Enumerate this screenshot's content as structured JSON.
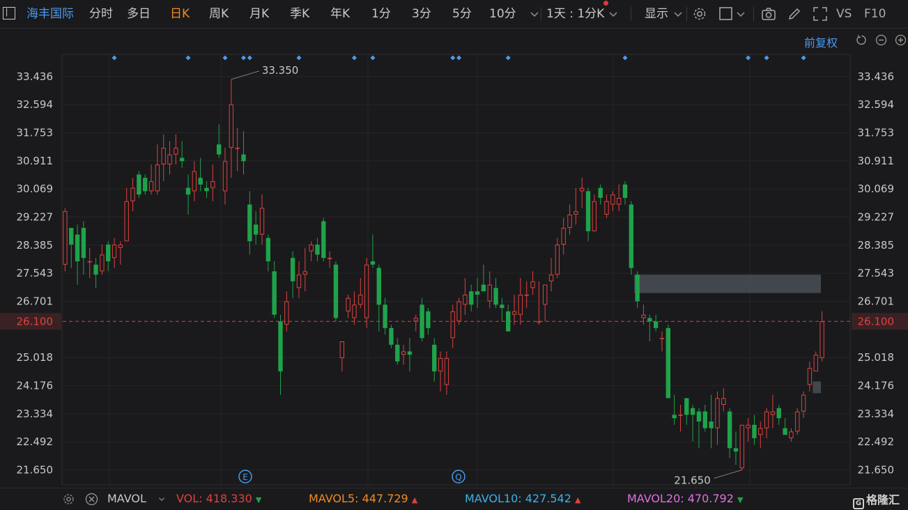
{
  "toolbar": {
    "stock_name": "海丰国际",
    "periods": [
      "分时",
      "多日",
      "日K",
      "周K",
      "月K",
      "季K",
      "年K",
      "1分",
      "3分",
      "5分",
      "10分"
    ],
    "active_period": "日K",
    "interval": "1天 : 1分K",
    "display": "显示",
    "vs": "VS",
    "f10": "F10"
  },
  "adjust": "前复权",
  "price_axis": {
    "ticks": [
      "33.436",
      "32.594",
      "31.753",
      "30.911",
      "30.069",
      "29.227",
      "28.385",
      "27.543",
      "26.701",
      "25.018",
      "24.176",
      "23.334",
      "22.492",
      "21.650"
    ],
    "current_price": "26.100",
    "high_label": "33.350",
    "low_label": "21.650"
  },
  "event_markers": [
    "E",
    "Q"
  ],
  "volume_bar": {
    "indicator": "MAVOL",
    "vol_label": "VOL:",
    "vol": "418.330",
    "mavol5_label": "MAVOL5:",
    "mavol5": "447.729",
    "mavol10_label": "MAVOL10:",
    "mavol10": "427.542",
    "mavol20_label": "MAVOL20:",
    "mavol20": "470.792"
  },
  "brand": "格隆汇",
  "colors": {
    "up": "#e0413f",
    "down": "#1fa34a",
    "accent_blue": "#4a9af0",
    "active_orange": "#f08a24",
    "mavol5": "#f08a24",
    "mavol10": "#3fb0e8",
    "mavol20": "#e070e0"
  },
  "chart_data": {
    "type": "candlestick",
    "ylim": [
      21.2,
      34.1
    ],
    "candles": [
      {
        "o": 27.8,
        "h": 29.5,
        "l": 27.6,
        "c": 29.4
      },
      {
        "o": 28.9,
        "h": 28.9,
        "l": 27.7,
        "c": 28.4
      },
      {
        "o": 28.7,
        "h": 29.0,
        "l": 27.2,
        "c": 27.9
      },
      {
        "o": 28.9,
        "h": 29.1,
        "l": 27.5,
        "c": 28.0
      },
      {
        "o": 27.9,
        "h": 28.3,
        "l": 27.4,
        "c": 27.9
      },
      {
        "o": 27.8,
        "h": 28.0,
        "l": 27.1,
        "c": 27.5
      },
      {
        "o": 27.6,
        "h": 28.4,
        "l": 27.5,
        "c": 28.1
      },
      {
        "o": 28.4,
        "h": 28.5,
        "l": 27.6,
        "c": 27.9
      },
      {
        "o": 28.0,
        "h": 28.6,
        "l": 27.7,
        "c": 28.4
      },
      {
        "o": 28.3,
        "h": 28.5,
        "l": 27.8,
        "c": 28.4
      },
      {
        "o": 28.5,
        "h": 30.1,
        "l": 28.5,
        "c": 29.7
      },
      {
        "o": 29.7,
        "h": 30.4,
        "l": 29.4,
        "c": 30.1
      },
      {
        "o": 30.5,
        "h": 30.6,
        "l": 29.8,
        "c": 29.9
      },
      {
        "o": 30.4,
        "h": 30.5,
        "l": 29.9,
        "c": 30.0
      },
      {
        "o": 30.0,
        "h": 30.8,
        "l": 29.9,
        "c": 30.3
      },
      {
        "o": 30.0,
        "h": 31.4,
        "l": 29.9,
        "c": 30.8
      },
      {
        "o": 30.8,
        "h": 31.7,
        "l": 30.3,
        "c": 31.3
      },
      {
        "o": 30.8,
        "h": 31.5,
        "l": 30.5,
        "c": 31.1
      },
      {
        "o": 31.1,
        "h": 31.7,
        "l": 30.8,
        "c": 31.3
      },
      {
        "o": 31.0,
        "h": 31.5,
        "l": 30.7,
        "c": 30.9
      },
      {
        "o": 30.1,
        "h": 30.5,
        "l": 29.3,
        "c": 29.9
      },
      {
        "o": 30.0,
        "h": 30.9,
        "l": 29.7,
        "c": 30.6
      },
      {
        "o": 30.4,
        "h": 31.0,
        "l": 30.0,
        "c": 30.2
      },
      {
        "o": 30.1,
        "h": 30.3,
        "l": 29.8,
        "c": 30.0
      },
      {
        "o": 30.1,
        "h": 30.8,
        "l": 29.7,
        "c": 30.3
      },
      {
        "o": 31.4,
        "h": 32.0,
        "l": 31.0,
        "c": 31.1
      },
      {
        "o": 30.0,
        "h": 31.3,
        "l": 29.6,
        "c": 30.9
      },
      {
        "o": 31.3,
        "h": 33.35,
        "l": 30.4,
        "c": 32.6
      },
      {
        "o": 31.3,
        "h": 31.9,
        "l": 30.6,
        "c": 31.3
      },
      {
        "o": 31.1,
        "h": 31.8,
        "l": 30.5,
        "c": 30.9
      },
      {
        "o": 29.6,
        "h": 30.0,
        "l": 28.1,
        "c": 28.5
      },
      {
        "o": 29.0,
        "h": 29.4,
        "l": 28.4,
        "c": 28.7
      },
      {
        "o": 28.7,
        "h": 29.9,
        "l": 28.4,
        "c": 29.5
      },
      {
        "o": 28.6,
        "h": 28.7,
        "l": 27.6,
        "c": 27.9
      },
      {
        "o": 27.6,
        "h": 27.9,
        "l": 26.2,
        "c": 26.3
      },
      {
        "o": 26.1,
        "h": 26.3,
        "l": 23.9,
        "c": 24.6
      },
      {
        "o": 26.0,
        "h": 27.0,
        "l": 25.8,
        "c": 26.7
      },
      {
        "o": 28.0,
        "h": 28.2,
        "l": 26.8,
        "c": 27.3
      },
      {
        "o": 27.1,
        "h": 27.9,
        "l": 26.8,
        "c": 27.5
      },
      {
        "o": 27.5,
        "h": 28.3,
        "l": 27.0,
        "c": 27.6
      },
      {
        "o": 28.2,
        "h": 28.5,
        "l": 27.9,
        "c": 28.4
      },
      {
        "o": 28.4,
        "h": 28.6,
        "l": 27.9,
        "c": 28.1
      },
      {
        "o": 29.1,
        "h": 29.2,
        "l": 27.9,
        "c": 28.0
      },
      {
        "o": 28.0,
        "h": 28.2,
        "l": 27.7,
        "c": 28.0
      },
      {
        "o": 27.8,
        "h": 27.9,
        "l": 26.1,
        "c": 26.2
      },
      {
        "o": 25.0,
        "h": 25.5,
        "l": 24.6,
        "c": 25.5
      },
      {
        "o": 26.4,
        "h": 26.9,
        "l": 26.2,
        "c": 26.8
      },
      {
        "o": 26.2,
        "h": 27.0,
        "l": 26.0,
        "c": 26.6
      },
      {
        "o": 26.6,
        "h": 27.4,
        "l": 26.5,
        "c": 26.9
      },
      {
        "o": 26.2,
        "h": 28.0,
        "l": 25.9,
        "c": 27.8
      },
      {
        "o": 27.9,
        "h": 28.7,
        "l": 27.7,
        "c": 27.8
      },
      {
        "o": 27.7,
        "h": 27.8,
        "l": 25.8,
        "c": 26.6
      },
      {
        "o": 26.6,
        "h": 26.8,
        "l": 25.7,
        "c": 25.9
      },
      {
        "o": 25.9,
        "h": 26.0,
        "l": 25.3,
        "c": 25.4
      },
      {
        "o": 25.4,
        "h": 25.6,
        "l": 24.8,
        "c": 24.9
      },
      {
        "o": 25.1,
        "h": 25.4,
        "l": 24.8,
        "c": 25.2
      },
      {
        "o": 25.2,
        "h": 25.6,
        "l": 24.6,
        "c": 25.1
      },
      {
        "o": 26.1,
        "h": 26.3,
        "l": 25.8,
        "c": 26.2
      },
      {
        "o": 26.6,
        "h": 26.8,
        "l": 25.5,
        "c": 25.6
      },
      {
        "o": 26.4,
        "h": 26.5,
        "l": 25.7,
        "c": 25.9
      },
      {
        "o": 25.4,
        "h": 25.6,
        "l": 24.3,
        "c": 24.6
      },
      {
        "o": 24.6,
        "h": 25.2,
        "l": 24.0,
        "c": 25.0
      },
      {
        "o": 24.2,
        "h": 25.2,
        "l": 23.9,
        "c": 25.0
      },
      {
        "o": 25.6,
        "h": 26.6,
        "l": 25.3,
        "c": 26.4
      },
      {
        "o": 26.1,
        "h": 26.8,
        "l": 26.0,
        "c": 26.7
      },
      {
        "o": 26.6,
        "h": 27.4,
        "l": 26.3,
        "c": 26.9
      },
      {
        "o": 27.0,
        "h": 27.2,
        "l": 26.4,
        "c": 26.6
      },
      {
        "o": 27.0,
        "h": 27.4,
        "l": 26.5,
        "c": 26.9
      },
      {
        "o": 27.2,
        "h": 27.8,
        "l": 27.0,
        "c": 27.0
      },
      {
        "o": 26.7,
        "h": 27.6,
        "l": 26.5,
        "c": 27.2
      },
      {
        "o": 27.1,
        "h": 27.4,
        "l": 26.5,
        "c": 26.6
      },
      {
        "o": 26.6,
        "h": 26.8,
        "l": 26.1,
        "c": 26.5
      },
      {
        "o": 26.4,
        "h": 26.6,
        "l": 25.8,
        "c": 25.8
      },
      {
        "o": 26.3,
        "h": 26.9,
        "l": 26.0,
        "c": 26.4
      },
      {
        "o": 26.3,
        "h": 27.4,
        "l": 26.0,
        "c": 26.9
      },
      {
        "o": 26.9,
        "h": 27.3,
        "l": 26.5,
        "c": 26.9
      },
      {
        "o": 27.1,
        "h": 27.6,
        "l": 26.9,
        "c": 27.3
      },
      {
        "o": 26.1,
        "h": 27.3,
        "l": 26.0,
        "c": 26.1
      },
      {
        "o": 26.6,
        "h": 27.2,
        "l": 26.1,
        "c": 27.2
      },
      {
        "o": 27.3,
        "h": 28.0,
        "l": 27.0,
        "c": 27.5
      },
      {
        "o": 27.5,
        "h": 28.6,
        "l": 27.4,
        "c": 28.4
      },
      {
        "o": 28.4,
        "h": 29.2,
        "l": 28.1,
        "c": 28.9
      },
      {
        "o": 28.9,
        "h": 29.6,
        "l": 28.7,
        "c": 29.3
      },
      {
        "o": 29.3,
        "h": 30.1,
        "l": 29.0,
        "c": 29.4
      },
      {
        "o": 30.0,
        "h": 30.4,
        "l": 29.5,
        "c": 30.1
      },
      {
        "o": 30.0,
        "h": 30.1,
        "l": 28.5,
        "c": 28.8
      },
      {
        "o": 28.8,
        "h": 29.9,
        "l": 28.8,
        "c": 29.7
      },
      {
        "o": 30.1,
        "h": 30.2,
        "l": 29.6,
        "c": 29.8
      },
      {
        "o": 29.3,
        "h": 29.9,
        "l": 29.2,
        "c": 29.7
      },
      {
        "o": 29.6,
        "h": 30.0,
        "l": 29.4,
        "c": 29.9
      },
      {
        "o": 29.6,
        "h": 30.2,
        "l": 29.4,
        "c": 29.8
      },
      {
        "o": 30.2,
        "h": 30.3,
        "l": 29.6,
        "c": 29.8
      },
      {
        "o": 29.6,
        "h": 29.7,
        "l": 27.5,
        "c": 27.7
      },
      {
        "o": 27.5,
        "h": 27.6,
        "l": 26.5,
        "c": 26.7
      },
      {
        "o": 26.2,
        "h": 26.6,
        "l": 26.0,
        "c": 26.3
      },
      {
        "o": 26.2,
        "h": 26.3,
        "l": 25.5,
        "c": 26.1
      },
      {
        "o": 26.1,
        "h": 26.3,
        "l": 25.8,
        "c": 25.9
      },
      {
        "o": 25.6,
        "h": 25.8,
        "l": 25.2,
        "c": 25.6
      },
      {
        "o": 25.9,
        "h": 26.0,
        "l": 23.8,
        "c": 23.8
      },
      {
        "o": 23.3,
        "h": 23.9,
        "l": 23.0,
        "c": 23.2
      },
      {
        "o": 23.3,
        "h": 23.6,
        "l": 22.8,
        "c": 23.3
      },
      {
        "o": 23.8,
        "h": 23.8,
        "l": 23.0,
        "c": 23.3
      },
      {
        "o": 23.5,
        "h": 23.6,
        "l": 22.5,
        "c": 23.3
      },
      {
        "o": 23.4,
        "h": 23.5,
        "l": 22.3,
        "c": 23.1
      },
      {
        "o": 23.4,
        "h": 23.6,
        "l": 22.8,
        "c": 22.9
      },
      {
        "o": 23.1,
        "h": 23.9,
        "l": 22.3,
        "c": 22.9
      },
      {
        "o": 22.9,
        "h": 24.0,
        "l": 22.4,
        "c": 23.8
      },
      {
        "o": 23.6,
        "h": 24.1,
        "l": 23.4,
        "c": 23.8
      },
      {
        "o": 23.4,
        "h": 23.5,
        "l": 22.0,
        "c": 22.3
      },
      {
        "o": 22.3,
        "h": 22.8,
        "l": 21.8,
        "c": 22.2
      },
      {
        "o": 21.7,
        "h": 23.0,
        "l": 21.65,
        "c": 23.0
      },
      {
        "o": 22.9,
        "h": 23.2,
        "l": 22.5,
        "c": 23.0
      },
      {
        "o": 23.0,
        "h": 23.3,
        "l": 22.4,
        "c": 22.6
      },
      {
        "o": 22.7,
        "h": 23.1,
        "l": 22.3,
        "c": 22.9
      },
      {
        "o": 22.9,
        "h": 23.5,
        "l": 22.6,
        "c": 23.4
      },
      {
        "o": 23.3,
        "h": 23.9,
        "l": 22.9,
        "c": 23.4
      },
      {
        "o": 23.5,
        "h": 23.6,
        "l": 23.0,
        "c": 23.2
      },
      {
        "o": 22.9,
        "h": 23.2,
        "l": 22.7,
        "c": 22.7
      },
      {
        "o": 22.6,
        "h": 22.9,
        "l": 22.5,
        "c": 22.8
      },
      {
        "o": 22.8,
        "h": 23.5,
        "l": 22.7,
        "c": 23.4
      },
      {
        "o": 23.4,
        "h": 24.0,
        "l": 23.2,
        "c": 23.9
      },
      {
        "o": 24.2,
        "h": 24.9,
        "l": 24.0,
        "c": 24.7
      },
      {
        "o": 24.6,
        "h": 25.2,
        "l": 24.6,
        "c": 25.1
      },
      {
        "o": 25.0,
        "h": 26.4,
        "l": 24.9,
        "c": 26.1
      }
    ],
    "gap_zones": [
      {
        "top": 27.5,
        "bottom": 26.95,
        "from_index": 93,
        "to_index": 125
      },
      {
        "top": 24.3,
        "bottom": 23.95,
        "from_index": 122,
        "to_index": 125
      }
    ]
  }
}
